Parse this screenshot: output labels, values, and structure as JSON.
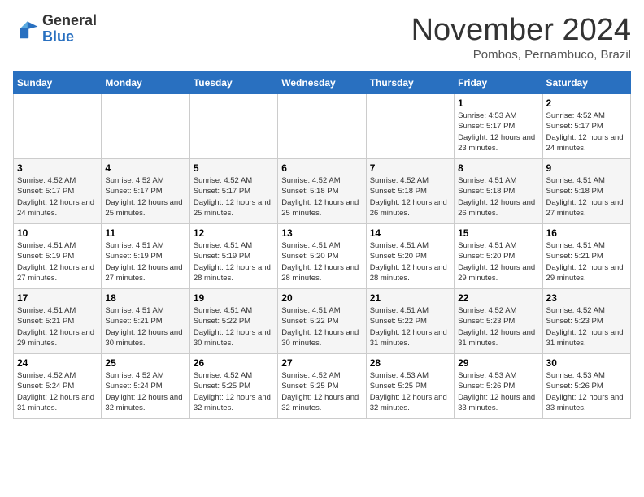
{
  "logo": {
    "general": "General",
    "blue": "Blue"
  },
  "header": {
    "month": "November 2024",
    "location": "Pombos, Pernambuco, Brazil"
  },
  "weekdays": [
    "Sunday",
    "Monday",
    "Tuesday",
    "Wednesday",
    "Thursday",
    "Friday",
    "Saturday"
  ],
  "weeks": [
    [
      {
        "day": "",
        "info": ""
      },
      {
        "day": "",
        "info": ""
      },
      {
        "day": "",
        "info": ""
      },
      {
        "day": "",
        "info": ""
      },
      {
        "day": "",
        "info": ""
      },
      {
        "day": "1",
        "info": "Sunrise: 4:53 AM\nSunset: 5:17 PM\nDaylight: 12 hours and 23 minutes."
      },
      {
        "day": "2",
        "info": "Sunrise: 4:52 AM\nSunset: 5:17 PM\nDaylight: 12 hours and 24 minutes."
      }
    ],
    [
      {
        "day": "3",
        "info": "Sunrise: 4:52 AM\nSunset: 5:17 PM\nDaylight: 12 hours and 24 minutes."
      },
      {
        "day": "4",
        "info": "Sunrise: 4:52 AM\nSunset: 5:17 PM\nDaylight: 12 hours and 25 minutes."
      },
      {
        "day": "5",
        "info": "Sunrise: 4:52 AM\nSunset: 5:17 PM\nDaylight: 12 hours and 25 minutes."
      },
      {
        "day": "6",
        "info": "Sunrise: 4:52 AM\nSunset: 5:18 PM\nDaylight: 12 hours and 25 minutes."
      },
      {
        "day": "7",
        "info": "Sunrise: 4:52 AM\nSunset: 5:18 PM\nDaylight: 12 hours and 26 minutes."
      },
      {
        "day": "8",
        "info": "Sunrise: 4:51 AM\nSunset: 5:18 PM\nDaylight: 12 hours and 26 minutes."
      },
      {
        "day": "9",
        "info": "Sunrise: 4:51 AM\nSunset: 5:18 PM\nDaylight: 12 hours and 27 minutes."
      }
    ],
    [
      {
        "day": "10",
        "info": "Sunrise: 4:51 AM\nSunset: 5:19 PM\nDaylight: 12 hours and 27 minutes."
      },
      {
        "day": "11",
        "info": "Sunrise: 4:51 AM\nSunset: 5:19 PM\nDaylight: 12 hours and 27 minutes."
      },
      {
        "day": "12",
        "info": "Sunrise: 4:51 AM\nSunset: 5:19 PM\nDaylight: 12 hours and 28 minutes."
      },
      {
        "day": "13",
        "info": "Sunrise: 4:51 AM\nSunset: 5:20 PM\nDaylight: 12 hours and 28 minutes."
      },
      {
        "day": "14",
        "info": "Sunrise: 4:51 AM\nSunset: 5:20 PM\nDaylight: 12 hours and 28 minutes."
      },
      {
        "day": "15",
        "info": "Sunrise: 4:51 AM\nSunset: 5:20 PM\nDaylight: 12 hours and 29 minutes."
      },
      {
        "day": "16",
        "info": "Sunrise: 4:51 AM\nSunset: 5:21 PM\nDaylight: 12 hours and 29 minutes."
      }
    ],
    [
      {
        "day": "17",
        "info": "Sunrise: 4:51 AM\nSunset: 5:21 PM\nDaylight: 12 hours and 29 minutes."
      },
      {
        "day": "18",
        "info": "Sunrise: 4:51 AM\nSunset: 5:21 PM\nDaylight: 12 hours and 30 minutes."
      },
      {
        "day": "19",
        "info": "Sunrise: 4:51 AM\nSunset: 5:22 PM\nDaylight: 12 hours and 30 minutes."
      },
      {
        "day": "20",
        "info": "Sunrise: 4:51 AM\nSunset: 5:22 PM\nDaylight: 12 hours and 30 minutes."
      },
      {
        "day": "21",
        "info": "Sunrise: 4:51 AM\nSunset: 5:22 PM\nDaylight: 12 hours and 31 minutes."
      },
      {
        "day": "22",
        "info": "Sunrise: 4:52 AM\nSunset: 5:23 PM\nDaylight: 12 hours and 31 minutes."
      },
      {
        "day": "23",
        "info": "Sunrise: 4:52 AM\nSunset: 5:23 PM\nDaylight: 12 hours and 31 minutes."
      }
    ],
    [
      {
        "day": "24",
        "info": "Sunrise: 4:52 AM\nSunset: 5:24 PM\nDaylight: 12 hours and 31 minutes."
      },
      {
        "day": "25",
        "info": "Sunrise: 4:52 AM\nSunset: 5:24 PM\nDaylight: 12 hours and 32 minutes."
      },
      {
        "day": "26",
        "info": "Sunrise: 4:52 AM\nSunset: 5:25 PM\nDaylight: 12 hours and 32 minutes."
      },
      {
        "day": "27",
        "info": "Sunrise: 4:52 AM\nSunset: 5:25 PM\nDaylight: 12 hours and 32 minutes."
      },
      {
        "day": "28",
        "info": "Sunrise: 4:53 AM\nSunset: 5:25 PM\nDaylight: 12 hours and 32 minutes."
      },
      {
        "day": "29",
        "info": "Sunrise: 4:53 AM\nSunset: 5:26 PM\nDaylight: 12 hours and 33 minutes."
      },
      {
        "day": "30",
        "info": "Sunrise: 4:53 AM\nSunset: 5:26 PM\nDaylight: 12 hours and 33 minutes."
      }
    ]
  ]
}
